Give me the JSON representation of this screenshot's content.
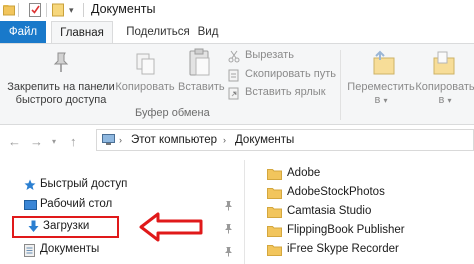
{
  "window": {
    "title": "Документы"
  },
  "ribbon_tabs": [
    "Файл",
    "Главная",
    "Поделиться",
    "Вид"
  ],
  "ribbon": {
    "pin_label_1": "Закрепить на панели",
    "pin_label_2": "быстрого доступа",
    "copy": "Копировать",
    "paste": "Вставить",
    "cut": "Вырезать",
    "copy_path": "Скопировать путь",
    "paste_shortcut": "Вставить ярлык",
    "clipboard_group": "Буфер обмена",
    "move_to_1": "Переместить",
    "move_to_2": "в",
    "copy_to_1": "Копировать",
    "copy_to_2": "в"
  },
  "address": {
    "crumbs": [
      "Этот компьютер",
      "Документы"
    ]
  },
  "nav_pane": {
    "items": [
      "Быстрый доступ",
      "Рабочий стол",
      "Загрузки",
      "Документы"
    ]
  },
  "files": [
    "Adobe",
    "AdobeStockPhotos",
    "Camtasia Studio",
    "FlippingBook Publisher",
    "iFree Skype Recorder"
  ],
  "colors": {
    "file_tab": "#1979ca",
    "highlight": "#e0191a",
    "folder": "#f2c55c"
  }
}
